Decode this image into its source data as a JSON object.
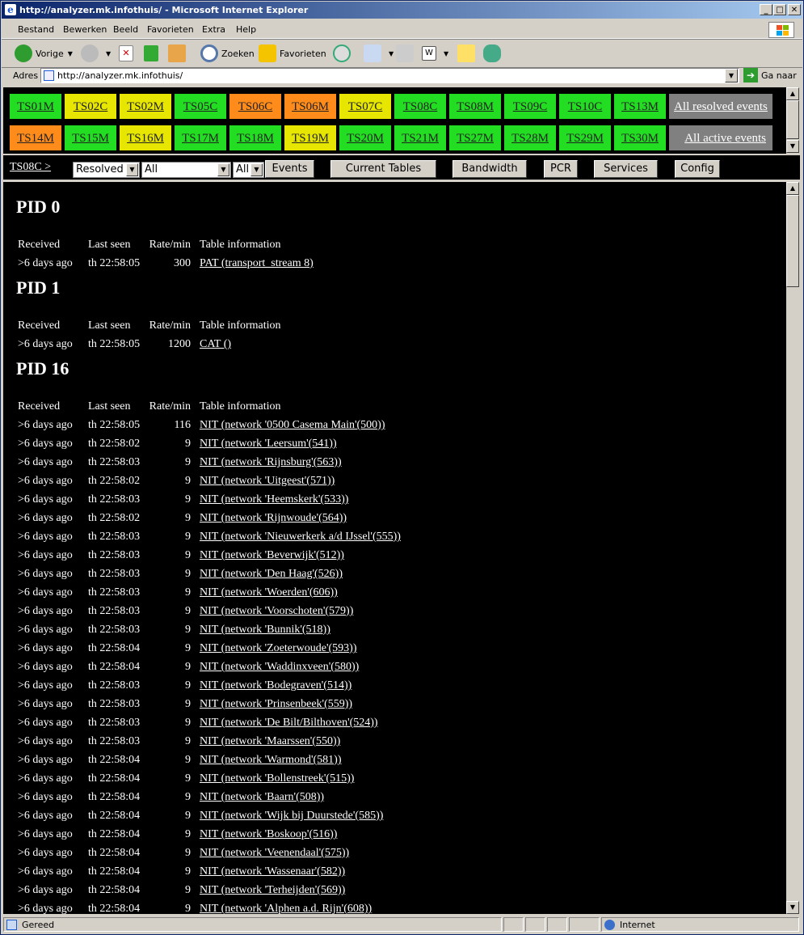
{
  "window": {
    "title": "http://analyzer.mk.infothuis/ - Microsoft Internet Explorer"
  },
  "menu": [
    "Bestand",
    "Bewerken",
    "Beeld",
    "Favorieten",
    "Extra",
    "Help"
  ],
  "toolbar": {
    "back": "Vorige",
    "search": "Zoeken",
    "favorites": "Favorieten"
  },
  "address": {
    "label": "Adres",
    "url": "http://analyzer.mk.infothuis/",
    "go": "Ga naar"
  },
  "tiles_row1": [
    {
      "label": "TS01M",
      "color": "green"
    },
    {
      "label": "TS02C",
      "color": "yellow"
    },
    {
      "label": "TS02M",
      "color": "yellow"
    },
    {
      "label": "TS05C",
      "color": "green"
    },
    {
      "label": "TS06C",
      "color": "orange"
    },
    {
      "label": "TS06M",
      "color": "orange"
    },
    {
      "label": "TS07C",
      "color": "yellow"
    },
    {
      "label": "TS08C",
      "color": "green"
    },
    {
      "label": "TS08M",
      "color": "green"
    },
    {
      "label": "TS09C",
      "color": "green"
    },
    {
      "label": "TS10C",
      "color": "green"
    },
    {
      "label": "TS13M",
      "color": "green"
    }
  ],
  "tiles_row2": [
    {
      "label": "TS14M",
      "color": "orange"
    },
    {
      "label": "TS15M",
      "color": "green"
    },
    {
      "label": "TS16M",
      "color": "yellow"
    },
    {
      "label": "TS17M",
      "color": "green"
    },
    {
      "label": "TS18M",
      "color": "green"
    },
    {
      "label": "TS19M",
      "color": "yellow"
    },
    {
      "label": "TS20M",
      "color": "green"
    },
    {
      "label": "TS21M",
      "color": "green"
    },
    {
      "label": "TS27M",
      "color": "green"
    },
    {
      "label": "TS28M",
      "color": "green"
    },
    {
      "label": "TS29M",
      "color": "green"
    },
    {
      "label": "TS30M",
      "color": "green"
    }
  ],
  "events_links": {
    "resolved": "All resolved events",
    "active": "All active events"
  },
  "nav": {
    "crumb": "TS08C >",
    "filter_state": "Resolved",
    "filter_type": "All",
    "filter_scope": "All",
    "buttons": [
      "Events",
      "Current Tables",
      "Bandwidth",
      "PCR",
      "Services",
      "Config"
    ]
  },
  "columns": [
    "Received",
    "Last seen",
    "Rate/min",
    "Table information"
  ],
  "sections": [
    {
      "title": "PID 0",
      "rows": [
        [
          "&gt;6 days ago",
          "th 22:58:05",
          "300",
          "PAT (transport_stream 8)"
        ]
      ]
    },
    {
      "title": "PID 1",
      "rows": [
        [
          "&gt;6 days ago",
          "th 22:58:05",
          "1200",
          "CAT ()"
        ]
      ]
    },
    {
      "title": "PID 16",
      "rows": [
        [
          "&gt;6 days ago",
          "th 22:58:05",
          "116",
          "NIT (network '0500 Casema Main'(500))"
        ],
        [
          "&gt;6 days ago",
          "th 22:58:02",
          "9",
          "NIT (network 'Leersum'(541))"
        ],
        [
          "&gt;6 days ago",
          "th 22:58:03",
          "9",
          "NIT (network 'Rijnsburg'(563))"
        ],
        [
          "&gt;6 days ago",
          "th 22:58:02",
          "9",
          "NIT (network 'Uitgeest'(571))"
        ],
        [
          "&gt;6 days ago",
          "th 22:58:03",
          "9",
          "NIT (network 'Heemskerk'(533))"
        ],
        [
          "&gt;6 days ago",
          "th 22:58:02",
          "9",
          "NIT (network 'Rijnwoude'(564))"
        ],
        [
          "&gt;6 days ago",
          "th 22:58:03",
          "9",
          "NIT (network 'Nieuwerkerk a/d IJssel'(555))"
        ],
        [
          "&gt;6 days ago",
          "th 22:58:03",
          "9",
          "NIT (network 'Beverwijk'(512))"
        ],
        [
          "&gt;6 days ago",
          "th 22:58:03",
          "9",
          "NIT (network 'Den Haag'(526))"
        ],
        [
          "&gt;6 days ago",
          "th 22:58:03",
          "9",
          "NIT (network 'Woerden'(606))"
        ],
        [
          "&gt;6 days ago",
          "th 22:58:03",
          "9",
          "NIT (network 'Voorschoten'(579))"
        ],
        [
          "&gt;6 days ago",
          "th 22:58:03",
          "9",
          "NIT (network 'Bunnik'(518))"
        ],
        [
          "&gt;6 days ago",
          "th 22:58:04",
          "9",
          "NIT (network 'Zoeterwoude'(593))"
        ],
        [
          "&gt;6 days ago",
          "th 22:58:04",
          "9",
          "NIT (network 'Waddinxveen'(580))"
        ],
        [
          "&gt;6 days ago",
          "th 22:58:03",
          "9",
          "NIT (network 'Bodegraven'(514))"
        ],
        [
          "&gt;6 days ago",
          "th 22:58:03",
          "9",
          "NIT (network 'Prinsenbeek'(559))"
        ],
        [
          "&gt;6 days ago",
          "th 22:58:03",
          "9",
          "NIT (network 'De Bilt/Bilthoven'(524))"
        ],
        [
          "&gt;6 days ago",
          "th 22:58:03",
          "9",
          "NIT (network 'Maarssen'(550))"
        ],
        [
          "&gt;6 days ago",
          "th 22:58:04",
          "9",
          "NIT (network 'Warmond'(581))"
        ],
        [
          "&gt;6 days ago",
          "th 22:58:04",
          "9",
          "NIT (network 'Bollenstreek'(515))"
        ],
        [
          "&gt;6 days ago",
          "th 22:58:04",
          "9",
          "NIT (network 'Baarn'(508))"
        ],
        [
          "&gt;6 days ago",
          "th 22:58:04",
          "9",
          "NIT (network 'Wijk bij Duurstede'(585))"
        ],
        [
          "&gt;6 days ago",
          "th 22:58:04",
          "9",
          "NIT (network 'Boskoop'(516))"
        ],
        [
          "&gt;6 days ago",
          "th 22:58:04",
          "9",
          "NIT (network 'Veenendaal'(575))"
        ],
        [
          "&gt;6 days ago",
          "th 22:58:04",
          "9",
          "NIT (network 'Wassenaar'(582))"
        ],
        [
          "&gt;6 days ago",
          "th 22:58:04",
          "9",
          "NIT (network 'Terheijden'(569))"
        ],
        [
          "&gt;6 days ago",
          "th 22:58:04",
          "9",
          "NIT (network 'Alphen a.d. Rijn'(608))"
        ]
      ]
    }
  ],
  "status": {
    "left": "Gereed",
    "zone": "Internet"
  },
  "colors": {
    "green": "#22dd22",
    "yellow": "#e6e600",
    "orange": "#ff8c1a",
    "grey": "#808080"
  }
}
